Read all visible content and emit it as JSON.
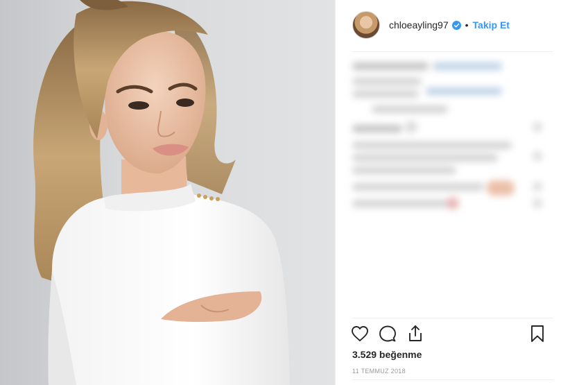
{
  "post": {
    "photo_alt": "",
    "header": {
      "username": "chloeayling97",
      "separator": "•",
      "follow_label": "Takip Et"
    },
    "actions": {
      "like_icon": "heart-icon",
      "comment_icon": "comment-icon",
      "share_icon": "share-icon",
      "save_icon": "bookmark-icon"
    },
    "likes_text": "3.529 beğenme",
    "date_text": "11 TEMMUZ 2018",
    "colors": {
      "follow": "#3897f0",
      "verified": "#3897f0",
      "text": "#262626",
      "muted": "#999999",
      "divider": "#efefef"
    }
  }
}
